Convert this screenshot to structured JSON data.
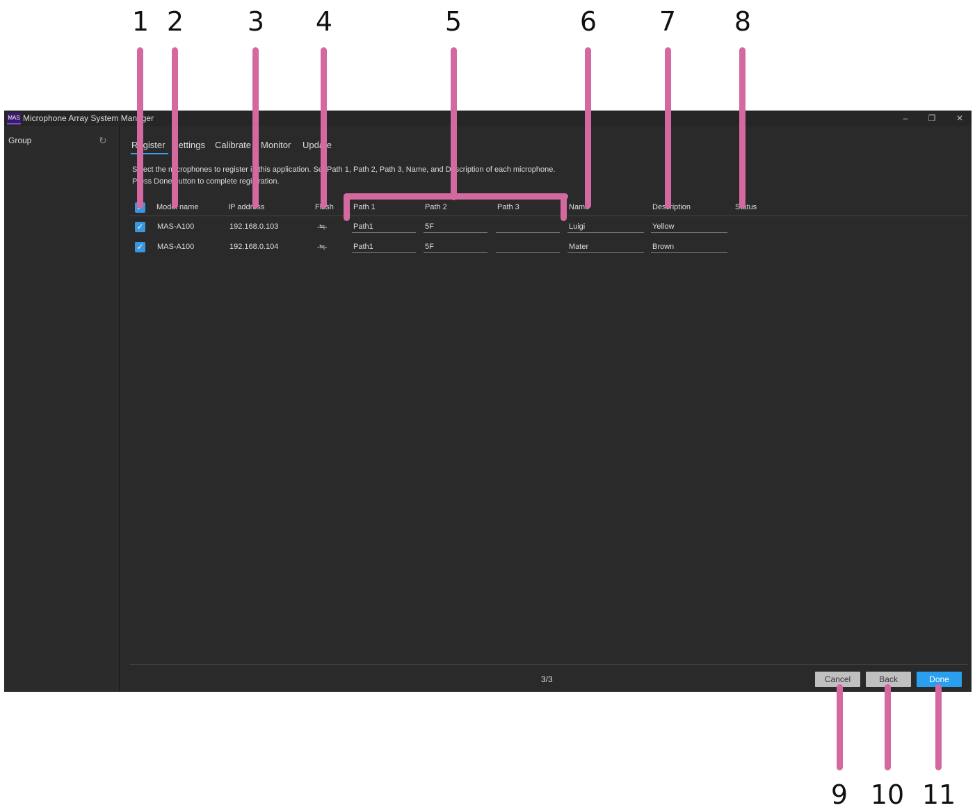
{
  "window": {
    "app_logo": "MAS",
    "title": "Microphone Array System Manager",
    "minimize_glyph": "–",
    "restore_glyph": "❐",
    "close_glyph": "✕"
  },
  "sidebar": {
    "label": "Group",
    "refresh_icon": "refresh-icon",
    "refresh_glyph": "↻"
  },
  "tabs": [
    {
      "label": "Register",
      "active": true
    },
    {
      "label": "Settings",
      "active": false
    },
    {
      "label": "Calibrate",
      "active": false
    },
    {
      "label": "Monitor",
      "active": false
    },
    {
      "label": "Update",
      "active": false
    }
  ],
  "instructions": {
    "line1": "Select the microphones to register in this application. Set Path 1, Path 2, Path 3, Name, and Description of each microphone.",
    "line2": "Press Done button to complete registration."
  },
  "table": {
    "headers": {
      "model": "Model name",
      "ip": "IP address",
      "flash": "Flash",
      "path1": "Path 1",
      "path2": "Path 2",
      "path3": "Path 3",
      "name": "Name",
      "description": "Description",
      "status": "Status"
    },
    "select_all_checked": true,
    "check_glyph": "✓",
    "flash_glyph": "-≒-",
    "rows": [
      {
        "checked": true,
        "model": "MAS-A100",
        "ip": "192.168.0.103",
        "path1": "Path1",
        "path2": "5F",
        "path3": "",
        "name": "Luigi",
        "description": "Yellow",
        "status": ""
      },
      {
        "checked": true,
        "model": "MAS-A100",
        "ip": "192.168.0.104",
        "path1": "Path1",
        "path2": "5F",
        "path3": "",
        "name": "Mater",
        "description": "Brown",
        "status": ""
      }
    ]
  },
  "footer": {
    "page_indicator": "3/3",
    "cancel_label": "Cancel",
    "back_label": "Back",
    "done_label": "Done"
  },
  "callouts": {
    "top": [
      "1",
      "2",
      "3",
      "4",
      "5",
      "6",
      "7",
      "8"
    ],
    "bottom": [
      "9",
      "10",
      "11"
    ]
  },
  "colors": {
    "callout": "#d4699f",
    "accent": "#2a9ff0",
    "background": "#2a2a2a"
  }
}
